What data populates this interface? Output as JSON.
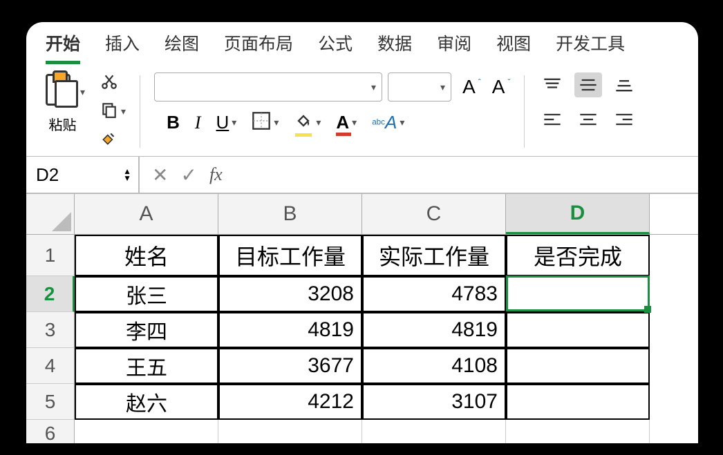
{
  "tabs": {
    "start": "开始",
    "insert": "插入",
    "draw": "绘图",
    "pagelayout": "页面布局",
    "formulas": "公式",
    "data": "数据",
    "review": "审阅",
    "view": "视图",
    "developer": "开发工具"
  },
  "ribbon": {
    "paste_label": "粘贴"
  },
  "namebox": "D2",
  "formula": "",
  "columns": [
    "A",
    "B",
    "C",
    "D"
  ],
  "row_numbers": [
    "1",
    "2",
    "3",
    "4",
    "5",
    "6"
  ],
  "headers": {
    "A": "姓名",
    "B": "目标工作量",
    "C": "实际工作量",
    "D": "是否完成"
  },
  "rows": [
    {
      "name": "张三",
      "target": "3208",
      "actual": "4783",
      "done": ""
    },
    {
      "name": "李四",
      "target": "4819",
      "actual": "4819",
      "done": ""
    },
    {
      "name": "王五",
      "target": "3677",
      "actual": "4108",
      "done": ""
    },
    {
      "name": "赵六",
      "target": "4212",
      "actual": "3107",
      "done": ""
    }
  ],
  "active_cell": "D2"
}
